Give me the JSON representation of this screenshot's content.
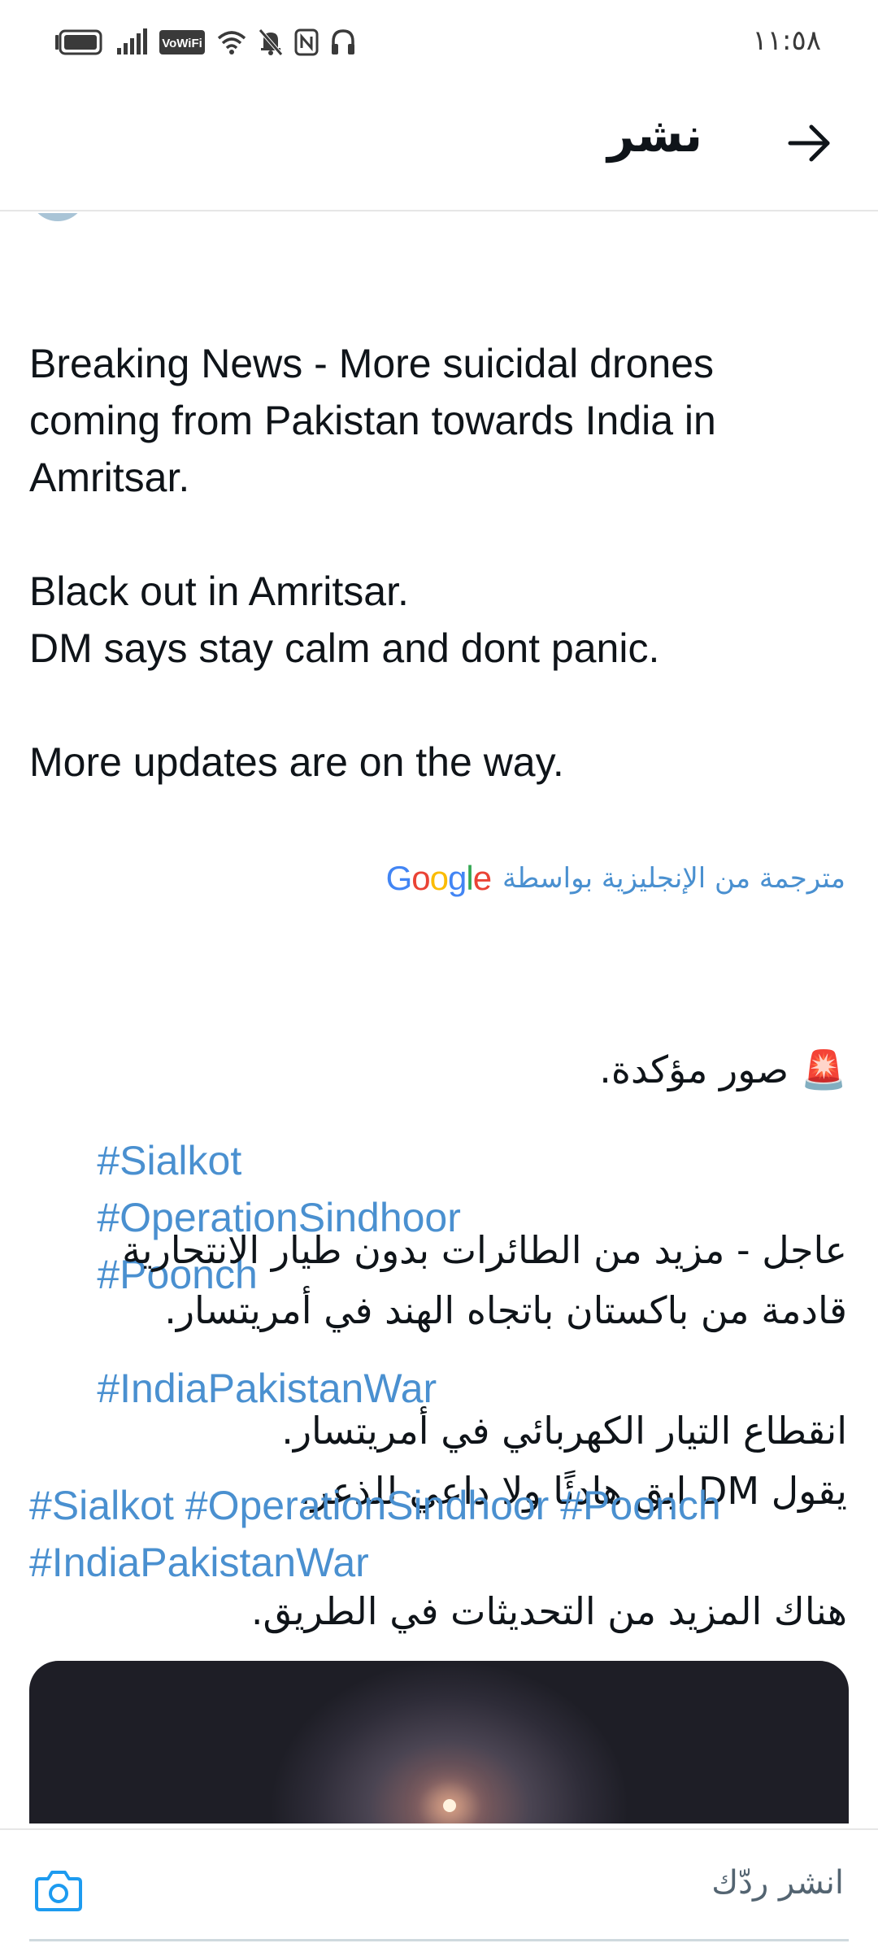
{
  "status_bar": {
    "time": "١١:٥٨",
    "icons": [
      "battery-icon",
      "signal-icon",
      "vowifi-icon",
      "wifi-icon",
      "mute-bell-icon",
      "nfc-icon",
      "headphones-icon"
    ],
    "vowifi_label": "VoWiFi"
  },
  "header": {
    "title": "نشر",
    "back_icon": "arrow-right-icon"
  },
  "tweet": {
    "text_en": "Breaking News - More suicidal drones\ncoming from Pakistan towards India in\nAmritsar.\n\nBlack out in Amritsar.\nDM says stay calm and dont panic.\n\nMore updates are on the way.",
    "hashtags_line1": [
      "#Sialkot",
      "#OperationSindhoor",
      "#Poonch"
    ],
    "hashtags_line2": [
      "#IndiaPakistanWar"
    ],
    "translation_label": "مترجمة من الإنجليزية بواسطة",
    "translation_provider": "Google",
    "siren_emoji": "🚨",
    "text_ar_first": "صور مؤكدة.",
    "text_ar": "عاجل - مزيد من الطائرات بدون طيار الانتحارية\nقادمة من باكستان باتجاه الهند في أمريتسار.\n\nانقطاع التيار الكهربائي في أمريتسار.\nيقول DM ابق هادئًا ولا داعي للذعر.\n\nهناك المزيد من التحديثات في الطريق.",
    "hashtags_ar_line1": [
      "#Sialkot",
      "#OperationSindhoor",
      "#Poonch"
    ],
    "hashtags_ar_line2": [
      "#IndiaPakistanWar"
    ]
  },
  "reply_bar": {
    "placeholder": "انشر ردّك",
    "camera_icon": "camera-icon"
  },
  "colors": {
    "link": "#4a90d0",
    "text": "#0f1419",
    "muted": "#536471",
    "accent": "#1d9bf0"
  }
}
